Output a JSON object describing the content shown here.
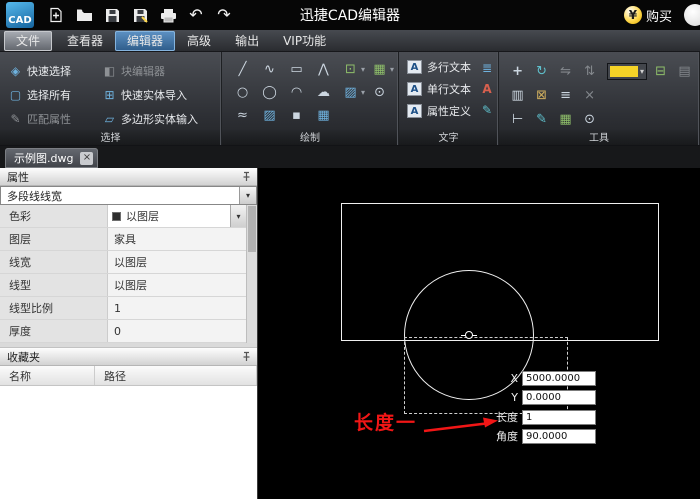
{
  "titlebar": {
    "logo_text": "CAD",
    "app_title": "迅捷CAD编辑器",
    "buy_label": "购买",
    "yen_symbol": "¥"
  },
  "menubar": {
    "items": [
      {
        "label": "文件"
      },
      {
        "label": "查看器"
      },
      {
        "label": "编辑器"
      },
      {
        "label": "高级"
      },
      {
        "label": "输出"
      },
      {
        "label": "VIP功能"
      }
    ],
    "active": "编辑器"
  },
  "ribbon": {
    "groups": {
      "selection": {
        "label": "选择",
        "buttons": [
          {
            "label": "快速选择",
            "enabled": true
          },
          {
            "label": "块编辑器",
            "enabled": false
          },
          {
            "label": "选择所有",
            "enabled": true
          },
          {
            "label": "快速实体导入",
            "enabled": true
          },
          {
            "label": "匹配属性",
            "enabled": false
          },
          {
            "label": "多边形实体输入",
            "enabled": true
          }
        ]
      },
      "draw": {
        "label": "绘制"
      },
      "text": {
        "label": "文字",
        "buttons": [
          {
            "label": "多行文本"
          },
          {
            "label": "单行文本"
          },
          {
            "label": "属性定义"
          }
        ]
      },
      "tools": {
        "label": "工具"
      }
    }
  },
  "tabbar": {
    "active_tab": "示例图.dwg",
    "close_glyph": "×"
  },
  "properties": {
    "title": "属性",
    "selector_value": "多段线线宽",
    "rows": [
      {
        "label": "色彩",
        "value": "以图层"
      },
      {
        "label": "图层",
        "value": "家具"
      },
      {
        "label": "线宽",
        "value": "以图层"
      },
      {
        "label": "线型",
        "value": "以图层"
      },
      {
        "label": "线型比例",
        "value": "1"
      },
      {
        "label": "厚度",
        "value": "0"
      }
    ]
  },
  "favorites": {
    "title": "收藏夹",
    "columns": [
      {
        "label": "名称"
      },
      {
        "label": "路径"
      }
    ]
  },
  "canvas": {
    "coord_inputs": [
      {
        "label": "X",
        "value": "5000.0000"
      },
      {
        "label": "Y",
        "value": "0.0000"
      },
      {
        "label": "长度",
        "value": "1"
      },
      {
        "label": "角度",
        "value": "90.0000"
      }
    ],
    "annotation_text": "长度一"
  },
  "colors": {
    "accent_blue": "#2f86c8",
    "annotation_red": "#f11616",
    "canvas_bg": "#000000",
    "swatch_yellow": "#f5d327",
    "entity_white": "#f0f0f0"
  },
  "icons": {
    "quick_select": "◈",
    "block_editor": "◧",
    "select_all": "▢",
    "quick_import": "⊞",
    "match_props": "✎",
    "polygon_input": "▱",
    "line": "╱",
    "spline": "∿",
    "rect": "▭",
    "polyline": "⋀",
    "insert": "⊡",
    "array": "▦",
    "circle": "○",
    "ellipse": "◯",
    "arc": "◠",
    "cloud": "☁",
    "hatch": "▨",
    "donut": "⊙",
    "sketch": "≈",
    "point": "▪",
    "table": "▦",
    "text_a": "A",
    "align": "≣",
    "pencil": "✎",
    "move": "+",
    "rotate": "↻",
    "mirror": "⇋",
    "offset": "⇅",
    "copy": "⊟",
    "paste": "▤",
    "clipboard": "▥",
    "block": "⊠",
    "layers": "≡",
    "erase": "×",
    "measure": "⊢",
    "dropdown": "▾",
    "undo": "↶",
    "redo": "↷"
  }
}
